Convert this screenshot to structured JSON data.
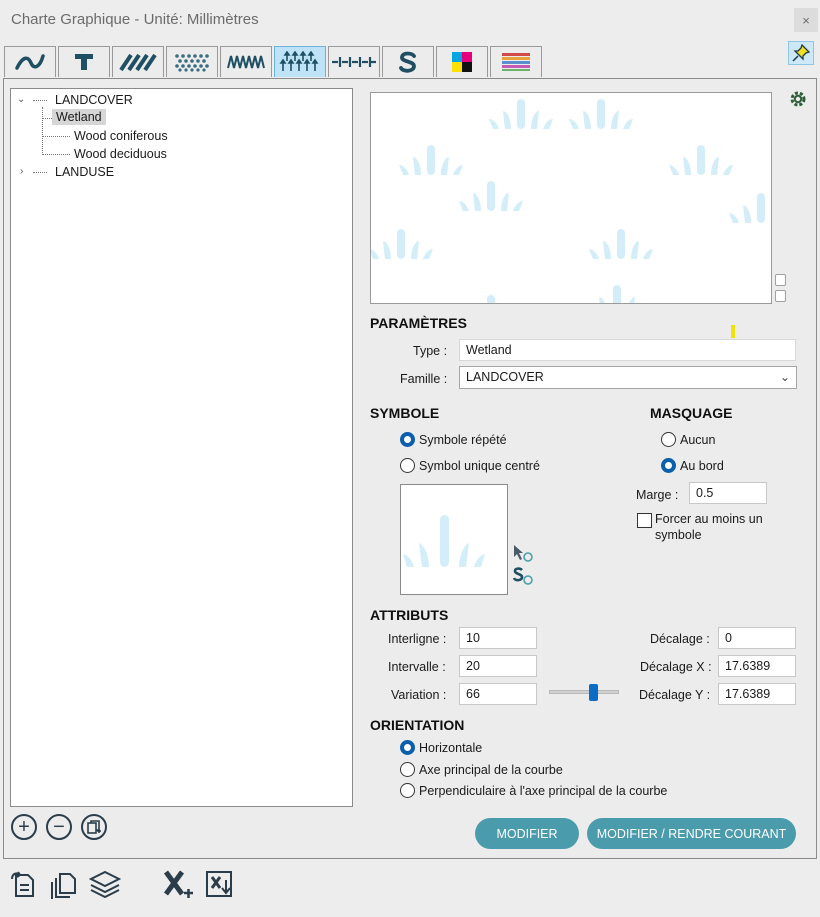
{
  "window": {
    "title": "Charte Graphique - Unité: Millimètres",
    "close_glyph": "×"
  },
  "tabs": [
    {
      "icon": "curve-line-icon",
      "active": false
    },
    {
      "icon": "text-t-icon",
      "active": false
    },
    {
      "icon": "hatch-pattern-icon",
      "active": false
    },
    {
      "icon": "dot-pattern-icon",
      "active": false
    },
    {
      "icon": "zigzag-pattern-icon",
      "active": false
    },
    {
      "icon": "symbol-fill-icon",
      "active": true
    },
    {
      "icon": "dash-line-icon",
      "active": false
    },
    {
      "icon": "s-symbol-icon",
      "active": false
    },
    {
      "icon": "color-squares-icon",
      "active": false
    },
    {
      "icon": "color-gradient-icon",
      "active": false
    }
  ],
  "tree": {
    "root": {
      "label": "LANDCOVER",
      "expanded": true
    },
    "children": [
      {
        "label": "Wetland",
        "selected": true
      },
      {
        "label": "Wood coniferous",
        "selected": false
      },
      {
        "label": "Wood deciduous",
        "selected": false
      }
    ],
    "second_root": {
      "label": "LANDUSE",
      "expanded": false
    }
  },
  "parametres": {
    "title": "PARAMÈTRES",
    "type_label": "Type :",
    "type_value": "Wetland",
    "famille_label": "Famille :",
    "famille_value": "LANDCOVER"
  },
  "symbole": {
    "title": "SYMBOLE",
    "option_repete": "Symbole répété",
    "option_unique": "Symbol unique centré",
    "selected": "repete"
  },
  "masquage": {
    "title": "MASQUAGE",
    "option_aucun": "Aucun",
    "option_bord": "Au bord",
    "selected": "bord",
    "marge_label": "Marge :",
    "marge_value": "0.5",
    "forcer_label_line1": "Forcer au moins un",
    "forcer_label_line2": "symbole",
    "forcer_checked": false
  },
  "attributs": {
    "title": "ATTRIBUTS",
    "interligne_label": "Interligne :",
    "interligne_value": "10",
    "intervalle_label": "Intervalle :",
    "intervalle_value": "20",
    "variation_label": "Variation :",
    "variation_value": "66",
    "decalage_label": "Décalage :",
    "decalage_value": "0",
    "decalage_x_label": "Décalage X :",
    "decalage_x_value": "17.6389",
    "decalage_y_label": "Décalage Y :",
    "decalage_y_value": "17.6389"
  },
  "orientation": {
    "title": "ORIENTATION",
    "option_horizontale": "Horizontale",
    "option_axe": "Axe principal de la courbe",
    "option_perp": "Perpendiculaire à l'axe principal de la courbe",
    "selected": "horizontale"
  },
  "buttons": {
    "modifier": "MODIFIER",
    "modifier_courant": "MODIFIER / RENDRE COURANT"
  },
  "colors": {
    "accent_button": "#4a9bab",
    "radio_selected": "#0b5fad",
    "symbol_fill": "#d4eef9",
    "active_tab": "#bfe3f6"
  }
}
